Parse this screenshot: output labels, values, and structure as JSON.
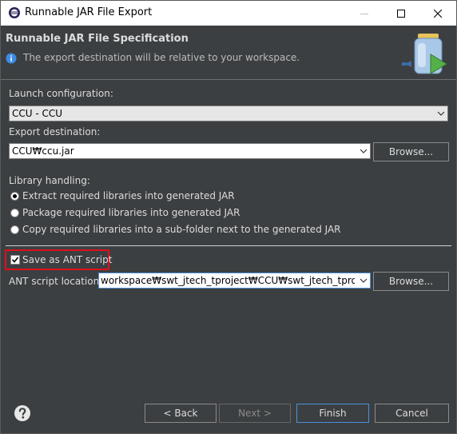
{
  "window": {
    "title": "Runnable JAR File Export"
  },
  "header": {
    "title": "Runnable JAR File Specification",
    "message": "The export destination will be relative to your workspace."
  },
  "launch": {
    "label": "Launch configuration:",
    "value": "CCU - CCU"
  },
  "export": {
    "label": "Export destination:",
    "value": "CCU₩ccu.jar",
    "browse_label": "Browse..."
  },
  "library": {
    "label": "Library handling:",
    "options": [
      {
        "label": "Extract required libraries into generated JAR",
        "selected": true
      },
      {
        "label": "Package required libraries into generated JAR",
        "selected": false
      },
      {
        "label": "Copy required libraries into a sub-folder next to the generated JAR",
        "selected": false
      }
    ]
  },
  "ant": {
    "checkbox_label": "Save as ANT script",
    "checked": true,
    "location_label": "ANT script location:",
    "location_value": "workspace₩swt_jtech_tproject₩CCU₩swt_jtech_tproject.xml",
    "browse_label": "Browse..."
  },
  "footer": {
    "back_label": "< Back",
    "next_label": "Next >",
    "finish_label": "Finish",
    "cancel_label": "Cancel"
  },
  "colors": {
    "highlight": "#e0101a",
    "dialog_bg": "#3c3f41"
  }
}
